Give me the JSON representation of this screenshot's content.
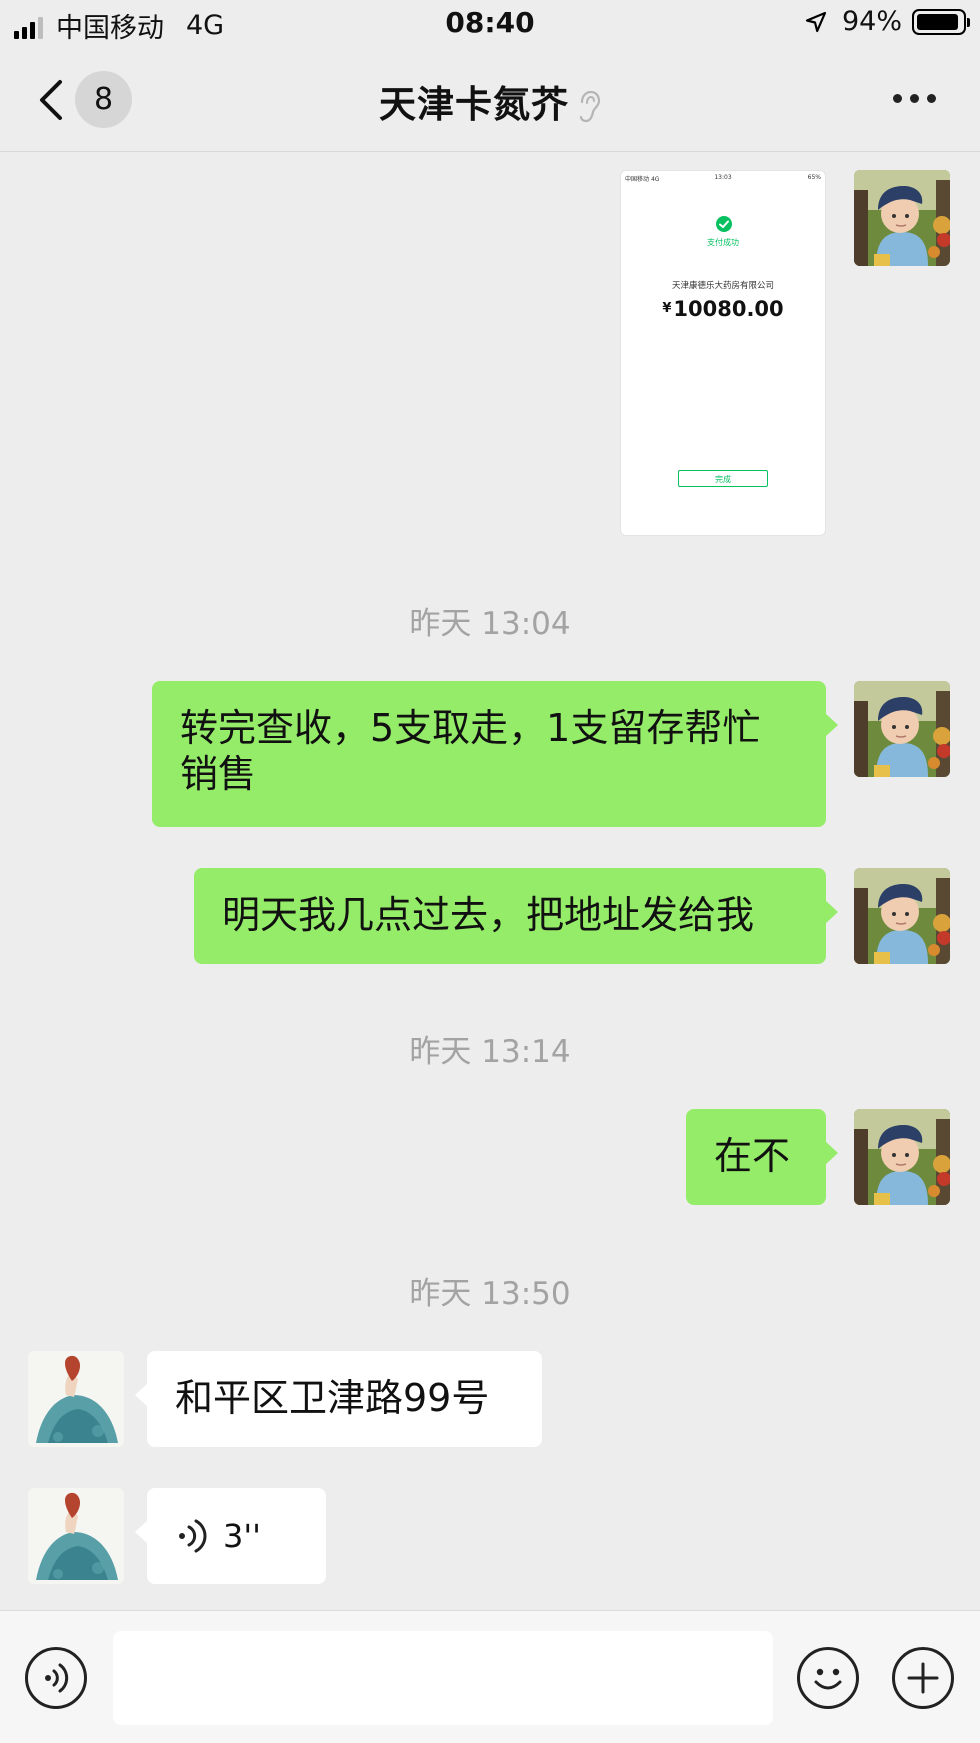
{
  "status_bar": {
    "carrier": "中国移动",
    "network": "4G",
    "time": "08:40",
    "battery": "94%",
    "battery_level": 0.94
  },
  "nav": {
    "title": "天津卡氮芥",
    "unread_count": "8"
  },
  "messages": [
    {
      "type": "image",
      "sender": "self",
      "image": {
        "status_carrier": "中国移动",
        "status_network": "4G",
        "status_time": "13:03",
        "status_battery": "65%",
        "success_label": "支付成功",
        "merchant": "天津康德乐大药房有限公司",
        "currency": "¥",
        "amount": "10080.00",
        "done_label": "完成"
      }
    },
    {
      "type": "time",
      "text": "昨天 13:04"
    },
    {
      "type": "text",
      "sender": "self",
      "text": "转完查收，5支取走，1支留存帮忙销售"
    },
    {
      "type": "text",
      "sender": "self",
      "text": "明天我几点过去，把地址发给我"
    },
    {
      "type": "time",
      "text": "昨天 13:14"
    },
    {
      "type": "text",
      "sender": "self",
      "text": "在不"
    },
    {
      "type": "time",
      "text": "昨天 13:50"
    },
    {
      "type": "text",
      "sender": "peer",
      "text": "和平区卫津路99号"
    },
    {
      "type": "voice",
      "sender": "peer",
      "duration": "3''"
    }
  ],
  "input": {
    "placeholder": ""
  },
  "icons": {
    "back": "chevron-left-icon",
    "ear": "ear-icon",
    "more": "more-dots-icon",
    "voice_mode": "voice-icon",
    "emoji": "emoji-icon",
    "add": "plus-icon",
    "pay_success": "check-icon"
  },
  "colors": {
    "background": "#ededed",
    "outgoing_bubble": "#95ec69",
    "incoming_bubble": "#ffffff",
    "wechat_green": "#07c160",
    "timestamp_text": "#a3a3a3"
  }
}
